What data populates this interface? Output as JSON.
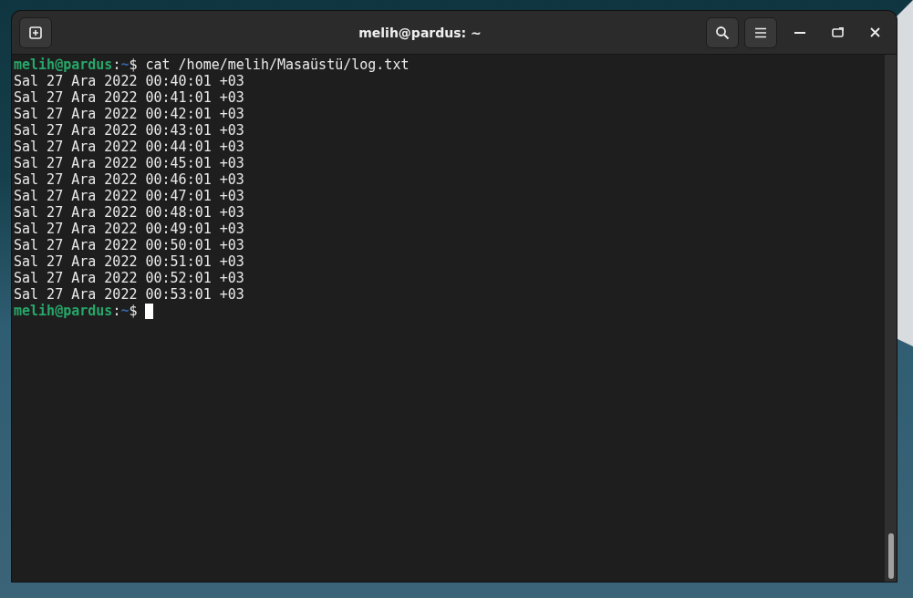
{
  "window": {
    "title": "melih@pardus: ~"
  },
  "terminal": {
    "lines": [
      {
        "kind": "prompt",
        "user_host": "melih@pardus",
        "separator": ":",
        "path": "~",
        "symbol": "$",
        "command": "cat /home/melih/Masaüstü/log.txt",
        "cursor": false
      },
      {
        "kind": "output",
        "text": "Sal 27 Ara 2022 00:40:01 +03"
      },
      {
        "kind": "output",
        "text": "Sal 27 Ara 2022 00:41:01 +03"
      },
      {
        "kind": "output",
        "text": "Sal 27 Ara 2022 00:42:01 +03"
      },
      {
        "kind": "output",
        "text": "Sal 27 Ara 2022 00:43:01 +03"
      },
      {
        "kind": "output",
        "text": "Sal 27 Ara 2022 00:44:01 +03"
      },
      {
        "kind": "output",
        "text": "Sal 27 Ara 2022 00:45:01 +03"
      },
      {
        "kind": "output",
        "text": "Sal 27 Ara 2022 00:46:01 +03"
      },
      {
        "kind": "output",
        "text": "Sal 27 Ara 2022 00:47:01 +03"
      },
      {
        "kind": "output",
        "text": "Sal 27 Ara 2022 00:48:01 +03"
      },
      {
        "kind": "output",
        "text": "Sal 27 Ara 2022 00:49:01 +03"
      },
      {
        "kind": "output",
        "text": "Sal 27 Ara 2022 00:50:01 +03"
      },
      {
        "kind": "output",
        "text": "Sal 27 Ara 2022 00:51:01 +03"
      },
      {
        "kind": "output",
        "text": "Sal 27 Ara 2022 00:52:01 +03"
      },
      {
        "kind": "output",
        "text": "Sal 27 Ara 2022 00:53:01 +03"
      },
      {
        "kind": "prompt",
        "user_host": "melih@pardus",
        "separator": ":",
        "path": "~",
        "symbol": "$",
        "cursor": true
      }
    ]
  }
}
